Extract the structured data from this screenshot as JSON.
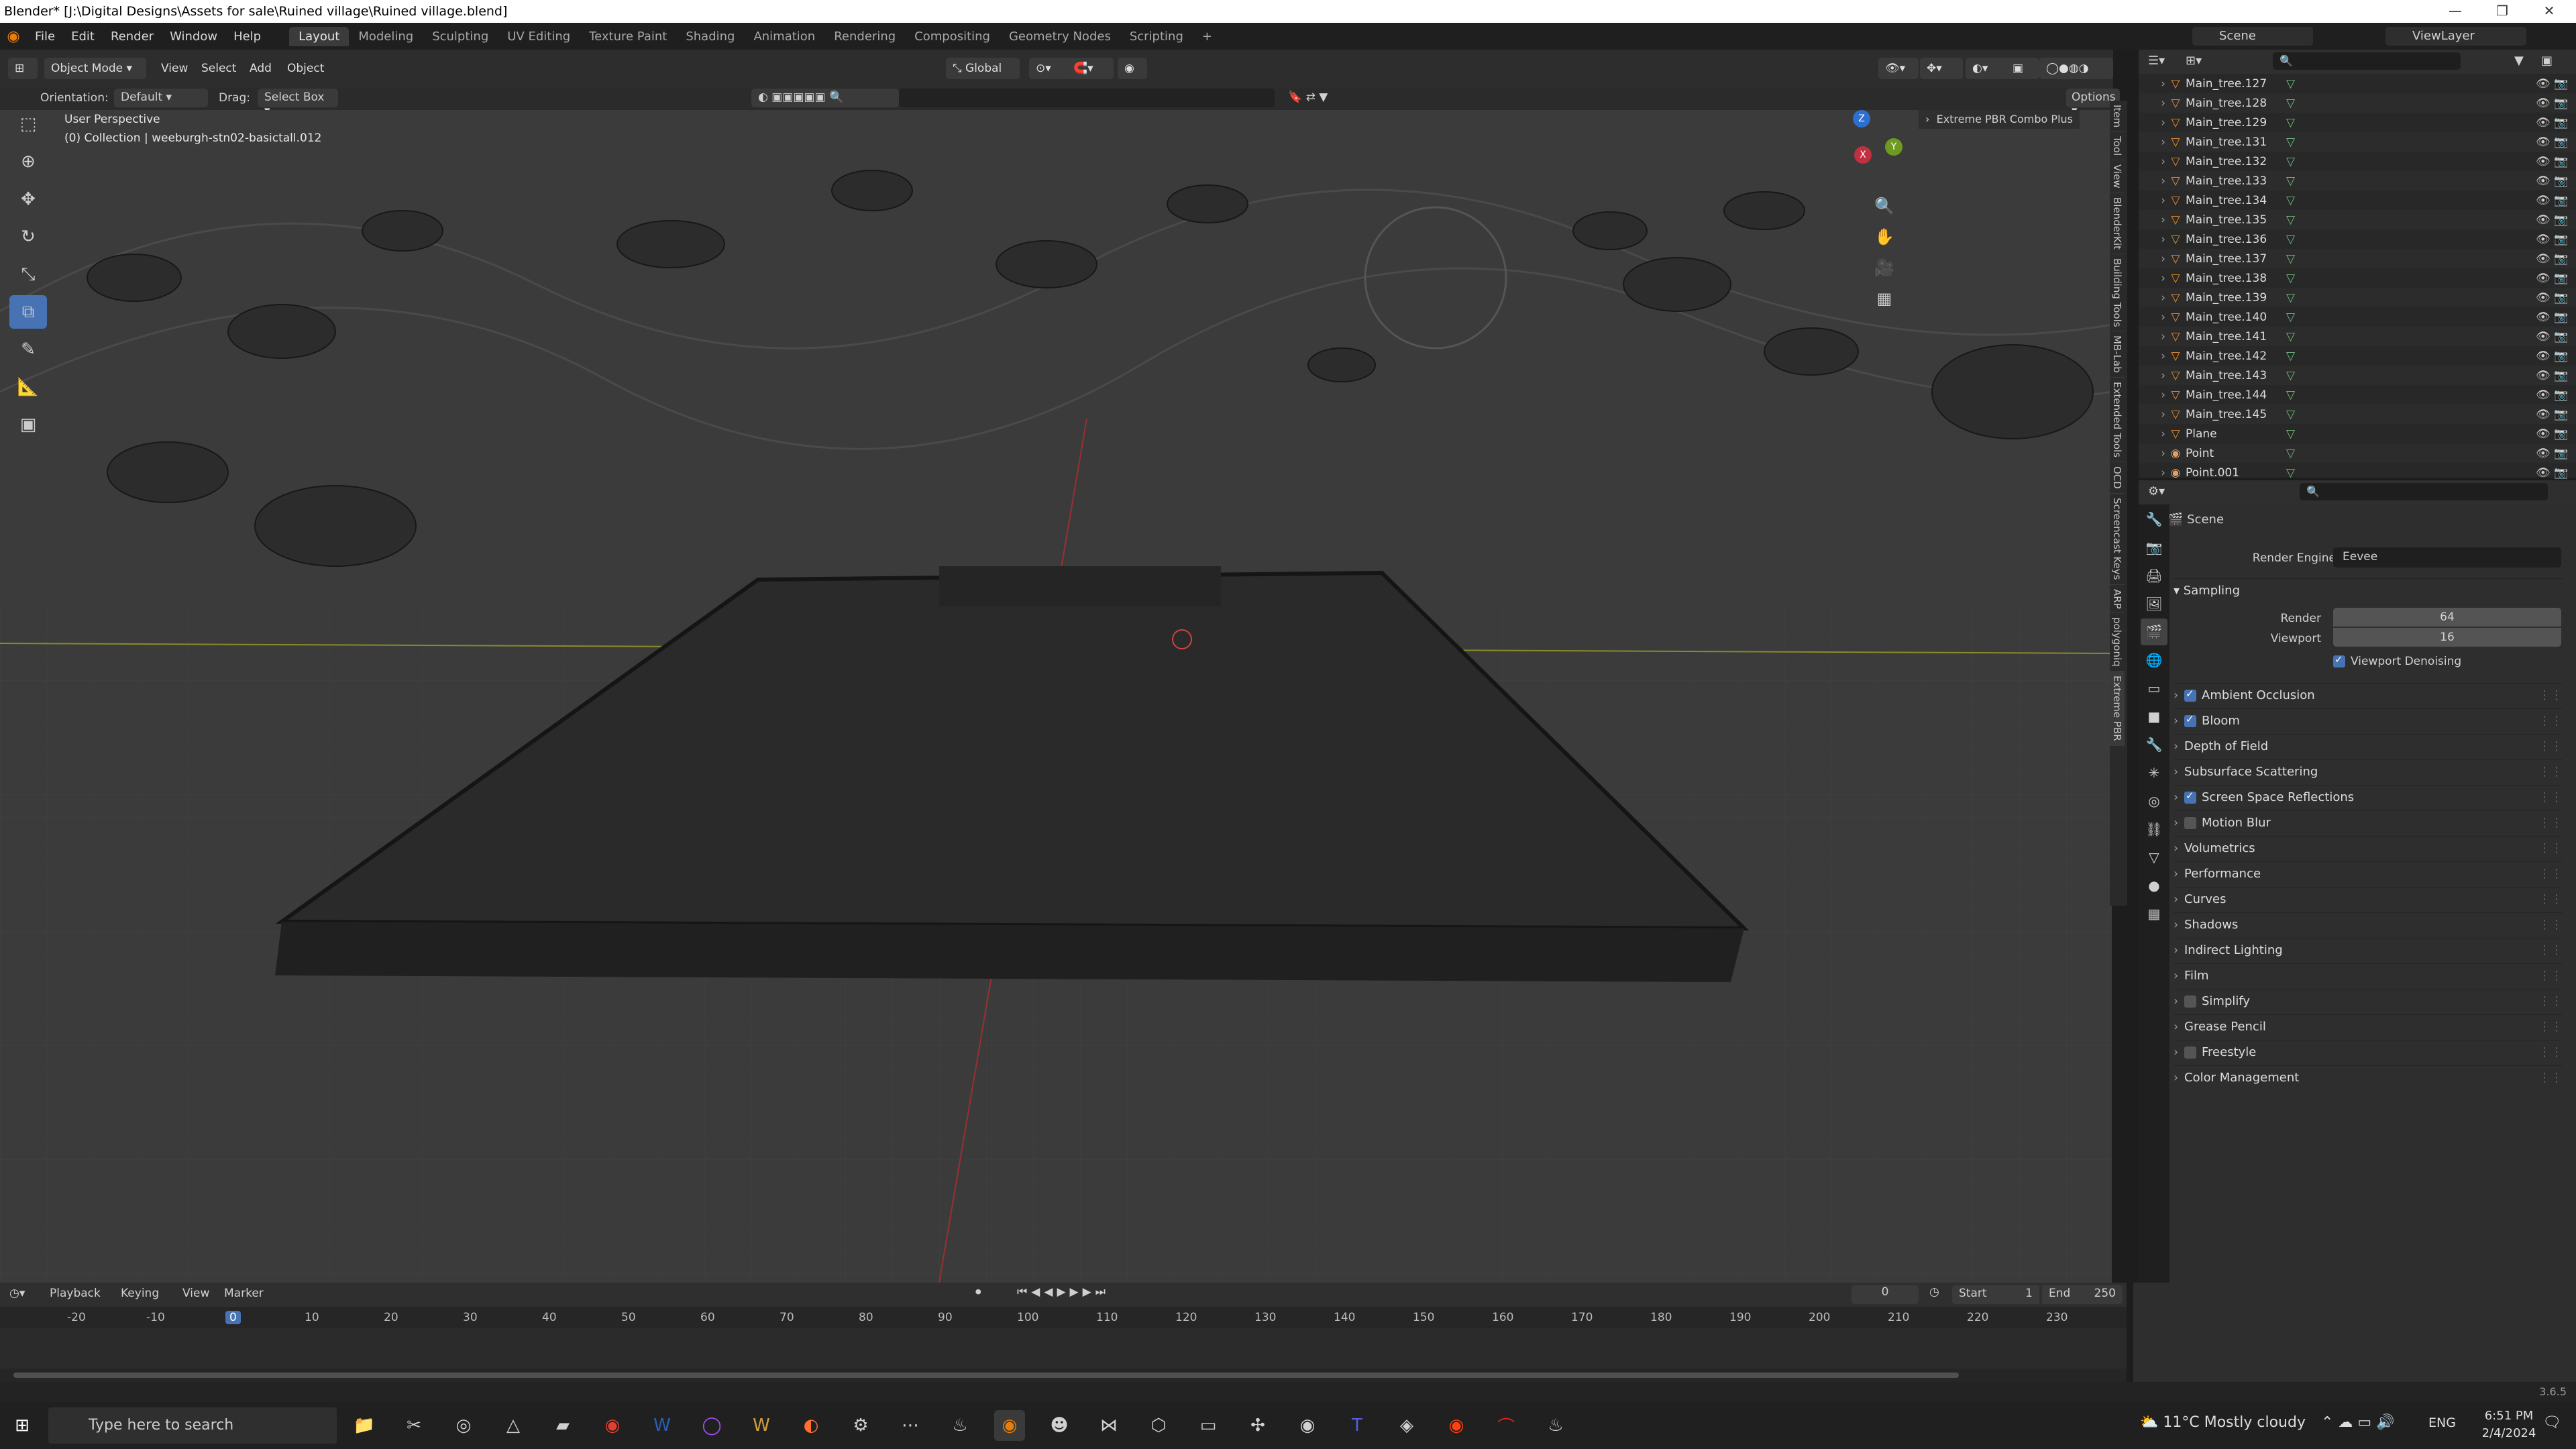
{
  "window": {
    "title": "Blender* [J:\\Digital Designs\\Assets for sale\\Ruined village\\Ruined village.blend]"
  },
  "menus": [
    "File",
    "Edit",
    "Render",
    "Window",
    "Help"
  ],
  "workspaces": [
    "Layout",
    "Modeling",
    "Sculpting",
    "UV Editing",
    "Texture Paint",
    "Shading",
    "Animation",
    "Rendering",
    "Compositing",
    "Geometry Nodes",
    "Scripting"
  ],
  "scene": {
    "name": "Scene",
    "view_layer": "ViewLayer"
  },
  "viewport": {
    "mode": "Object Mode",
    "menus": [
      "View",
      "Select",
      "Add",
      "Object"
    ],
    "transform_space": "Global",
    "orientation_label": "Orientation:",
    "orientation_value": "Default",
    "drag_label": "Drag:",
    "drag_value": "Select Box",
    "options": "Options",
    "overlay_title": "User Perspective",
    "overlay_subtitle": "(0) Collection | weeburgh-stn02-basictall.012",
    "addon_panel": "Extreme PBR Combo Plus",
    "side_tabs": [
      "Item",
      "Tool",
      "View",
      "BlenderKit",
      "Building Tools",
      "MB-Lab",
      "Extended Tools",
      "OCD",
      "Screencast Keys",
      "ARP",
      "polygoniq",
      "Extreme PBR"
    ]
  },
  "outliner": {
    "items": [
      "Main_tree.127",
      "Main_tree.128",
      "Main_tree.129",
      "Main_tree.131",
      "Main_tree.132",
      "Main_tree.133",
      "Main_tree.134",
      "Main_tree.135",
      "Main_tree.136",
      "Main_tree.137",
      "Main_tree.138",
      "Main_tree.139",
      "Main_tree.140",
      "Main_tree.141",
      "Main_tree.142",
      "Main_tree.143",
      "Main_tree.144",
      "Main_tree.145",
      "Plane",
      "Point",
      "Point.001"
    ]
  },
  "properties": {
    "context": "Scene",
    "render_engine_label": "Render Engine",
    "render_engine": "Eevee",
    "sampling": {
      "title": "Sampling",
      "render_label": "Render",
      "render": "64",
      "viewport_label": "Viewport",
      "viewport": "16",
      "denoise": "Viewport Denoising"
    },
    "panels": [
      {
        "label": "Ambient Occlusion",
        "checkbox": true,
        "checked": true
      },
      {
        "label": "Bloom",
        "checkbox": true,
        "checked": true
      },
      {
        "label": "Depth of Field",
        "checkbox": false,
        "checked": false
      },
      {
        "label": "Subsurface Scattering",
        "checkbox": false,
        "checked": false
      },
      {
        "label": "Screen Space Reflections",
        "checkbox": true,
        "checked": true
      },
      {
        "label": "Motion Blur",
        "checkbox": true,
        "checked": false
      },
      {
        "label": "Volumetrics",
        "checkbox": false,
        "checked": false
      },
      {
        "label": "Performance",
        "checkbox": false,
        "checked": false
      },
      {
        "label": "Curves",
        "checkbox": false,
        "checked": false
      },
      {
        "label": "Shadows",
        "checkbox": false,
        "checked": false
      },
      {
        "label": "Indirect Lighting",
        "checkbox": false,
        "checked": false
      },
      {
        "label": "Film",
        "checkbox": false,
        "checked": false
      },
      {
        "label": "Simplify",
        "checkbox": true,
        "checked": false
      },
      {
        "label": "Grease Pencil",
        "checkbox": false,
        "checked": false
      },
      {
        "label": "Freestyle",
        "checkbox": true,
        "checked": false
      },
      {
        "label": "Color Management",
        "checkbox": false,
        "checked": false
      }
    ]
  },
  "timeline": {
    "menus": [
      "Playback",
      "Keying",
      "View",
      "Marker"
    ],
    "current_frame": "0",
    "start_label": "Start",
    "start": "1",
    "end_label": "End",
    "end": "250",
    "ruler": [
      "-20",
      "-10",
      "0",
      "10",
      "20",
      "30",
      "40",
      "50",
      "60",
      "70",
      "80",
      "90",
      "100",
      "110",
      "120",
      "130",
      "140",
      "150",
      "160",
      "170",
      "180",
      "190",
      "200",
      "210",
      "220",
      "230"
    ]
  },
  "statusbar": {
    "version": "3.6.5"
  },
  "taskbar": {
    "search_placeholder": "Type here to search",
    "weather": "11°C  Mostly cloudy",
    "lang": "ENG",
    "time": "6:51 PM",
    "date": "2/4/2024"
  }
}
